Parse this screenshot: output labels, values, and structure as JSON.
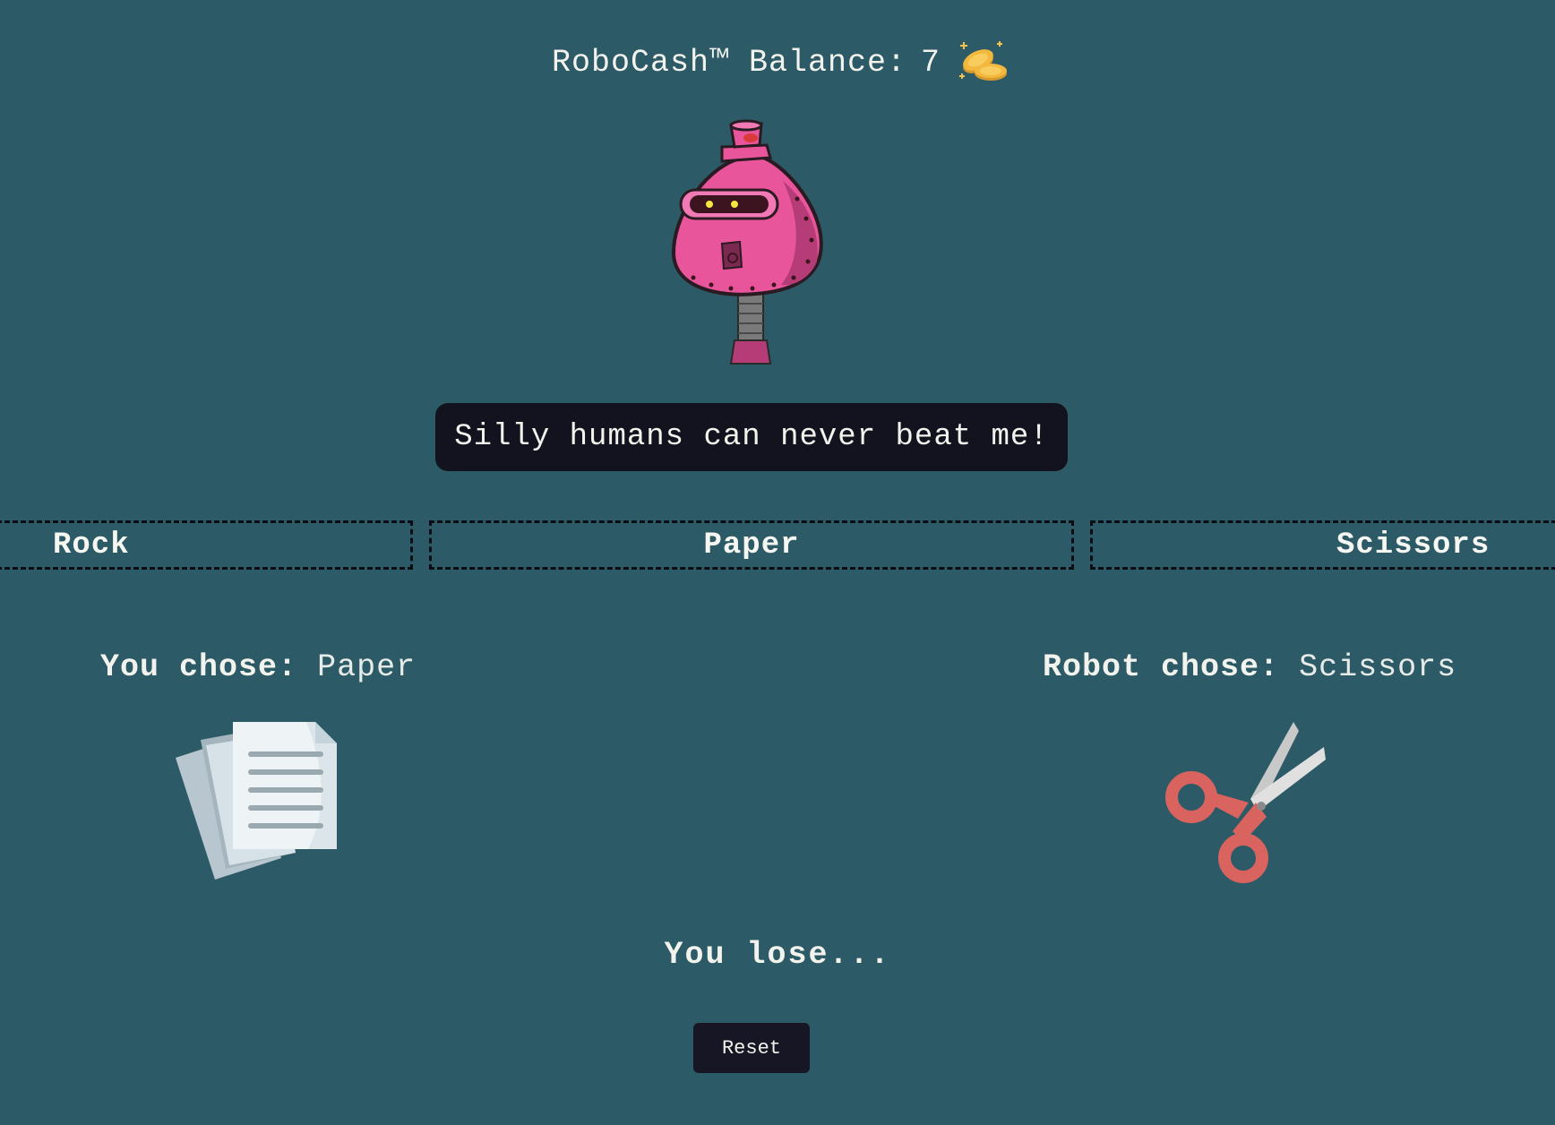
{
  "header": {
    "balance_label": "RoboCash™ Balance:",
    "balance_value": "7",
    "coin_icon": "coins-icon"
  },
  "robot": {
    "icon": "pink-robot-icon",
    "speech": "Silly humans can never beat me!"
  },
  "choices": [
    {
      "label": "Rock"
    },
    {
      "label": "Paper"
    },
    {
      "label": "Scissors"
    }
  ],
  "player": {
    "label": "You chose:",
    "value": "Paper",
    "icon": "paper-stack-icon"
  },
  "opponent": {
    "label": "Robot chose:",
    "value": "Scissors",
    "icon": "scissors-icon"
  },
  "result": "You lose...",
  "reset_label": "Reset",
  "colors": {
    "background": "#2c5a66",
    "dark": "#13131f",
    "robot_pink": "#e8559b",
    "scissors_red": "#d8635f"
  }
}
